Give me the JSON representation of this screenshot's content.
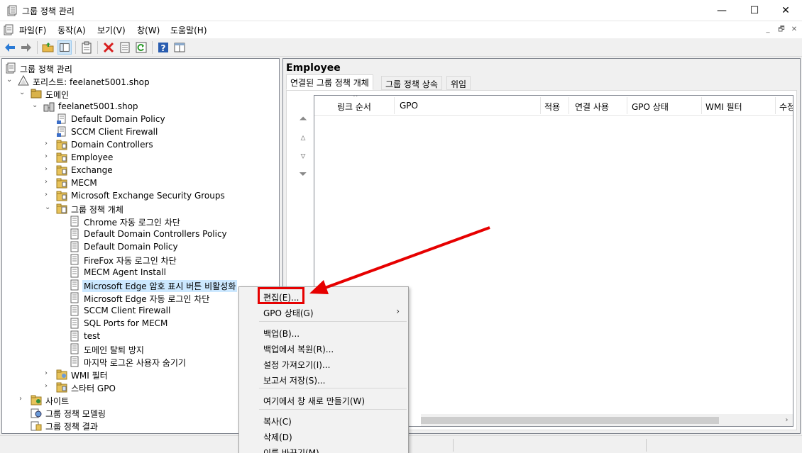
{
  "window": {
    "title": "그룹 정책 관리",
    "controls": [
      "—",
      "☐",
      "✕"
    ]
  },
  "menu": {
    "items": [
      "파일(F)",
      "동작(A)",
      "보기(V)",
      "창(W)",
      "도움말(H)"
    ],
    "mdi_controls": [
      "_",
      "🗗",
      "✕"
    ]
  },
  "tree": {
    "root": "그룹 정책 관리",
    "forest": "포리스트: feelanet5001.shop",
    "domains": "도메인",
    "domain": "feelanet5001.shop",
    "domain_children": [
      "Default Domain Policy",
      "SCCM Client Firewall",
      "Domain Controllers",
      "Employee",
      "Exchange",
      "MECM",
      "Microsoft Exchange Security Groups"
    ],
    "gpo_container": "그룹 정책 개체",
    "gpos": [
      "Chrome 자동 로그인 차단",
      "Default Domain Controllers Policy",
      "Default Domain Policy",
      "FireFox 자동 로그인 차단",
      "MECM Agent Install",
      "Microsoft Edge 암호 표시 버튼 비활성화",
      "Microsoft Edge 자동 로그인 차단",
      "SCCM Client Firewall",
      "SQL Ports for MECM",
      "test",
      "도메인 탈퇴 방지",
      "마지막 로그온 사용자 숨기기"
    ],
    "wmi": "WMI 필터",
    "starter": "스타터 GPO",
    "sites": "사이트",
    "modeling": "그룹 정책 모델링",
    "results": "그룹 정책 결과"
  },
  "right": {
    "title": "Employee",
    "tabs": [
      "연결된 그룹 정책 개체",
      "그룹 정책 상속",
      "위임"
    ],
    "columns": [
      "링크 순서",
      "GPO",
      "적용",
      "연결 사용",
      "GPO 상태",
      "WMI 필터",
      "수정"
    ]
  },
  "context_menu": {
    "items": [
      {
        "label": "편집(E)...",
        "submenu": false
      },
      {
        "label": "GPO 상태(G)",
        "submenu": true
      },
      {
        "label": "백업(B)...",
        "submenu": false
      },
      {
        "label": "백업에서 복원(R)...",
        "submenu": false
      },
      {
        "label": "설정 가져오기(I)...",
        "submenu": false
      },
      {
        "label": "보고서 저장(S)...",
        "submenu": false
      },
      {
        "label": "여기에서 창 새로 만들기(W)",
        "submenu": false
      },
      {
        "label": "복사(C)",
        "submenu": false
      },
      {
        "label": "삭제(D)",
        "submenu": false
      },
      {
        "label": "이름 바꾸기(M)",
        "submenu": false
      }
    ],
    "submenu_arrow": "›"
  },
  "colors": {
    "annotation_red": "#e60000",
    "selection": "#cce8ff"
  }
}
